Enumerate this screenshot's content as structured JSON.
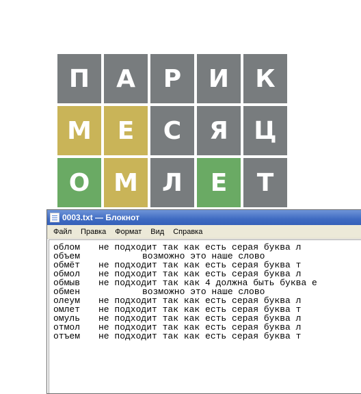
{
  "grid": {
    "rows": [
      {
        "tiles": [
          {
            "letter": "П",
            "state": "gray"
          },
          {
            "letter": "А",
            "state": "gray"
          },
          {
            "letter": "Р",
            "state": "gray"
          },
          {
            "letter": "И",
            "state": "gray"
          },
          {
            "letter": "К",
            "state": "gray"
          }
        ]
      },
      {
        "tiles": [
          {
            "letter": "М",
            "state": "yellow"
          },
          {
            "letter": "Е",
            "state": "yellow"
          },
          {
            "letter": "С",
            "state": "gray"
          },
          {
            "letter": "Я",
            "state": "gray"
          },
          {
            "letter": "Ц",
            "state": "gray"
          }
        ]
      },
      {
        "tiles": [
          {
            "letter": "О",
            "state": "green"
          },
          {
            "letter": "М",
            "state": "yellow"
          },
          {
            "letter": "Л",
            "state": "gray"
          },
          {
            "letter": "Е",
            "state": "green"
          },
          {
            "letter": "Т",
            "state": "gray"
          }
        ]
      }
    ],
    "colors": {
      "gray": "#787c7e",
      "yellow": "#c9b458",
      "green": "#6aaa64"
    }
  },
  "notepad": {
    "title": "0003.txt — Блокнот",
    "menu": [
      "Файл",
      "Правка",
      "Формат",
      "Вид",
      "Справка"
    ],
    "lines": [
      {
        "word": "облом",
        "note": "не подходит так как есть серая буква л",
        "center": false
      },
      {
        "word": "объем",
        "note": "возможно это наше слово",
        "center": true
      },
      {
        "word": "обмёт",
        "note": "не подходит так как есть серая буква т",
        "center": false
      },
      {
        "word": "обмол",
        "note": "не подходит так как есть серая буква л",
        "center": false
      },
      {
        "word": "обмыв",
        "note": "не подходит так как 4 должна быть буква е",
        "center": false
      },
      {
        "word": "обмен",
        "note": "возможно это наше слово",
        "center": true
      },
      {
        "word": "олеум",
        "note": "не подходит так как есть серая буква л",
        "center": false
      },
      {
        "word": "омлет",
        "note": "не подходит так как есть серая буква т",
        "center": false
      },
      {
        "word": "омуль",
        "note": "не подходит так как есть серая буква л",
        "center": false
      },
      {
        "word": "отмол",
        "note": "не подходит так как есть серая буква л",
        "center": false
      },
      {
        "word": "отъем",
        "note": "не подходит так как есть серая буква т",
        "center": false
      }
    ]
  }
}
